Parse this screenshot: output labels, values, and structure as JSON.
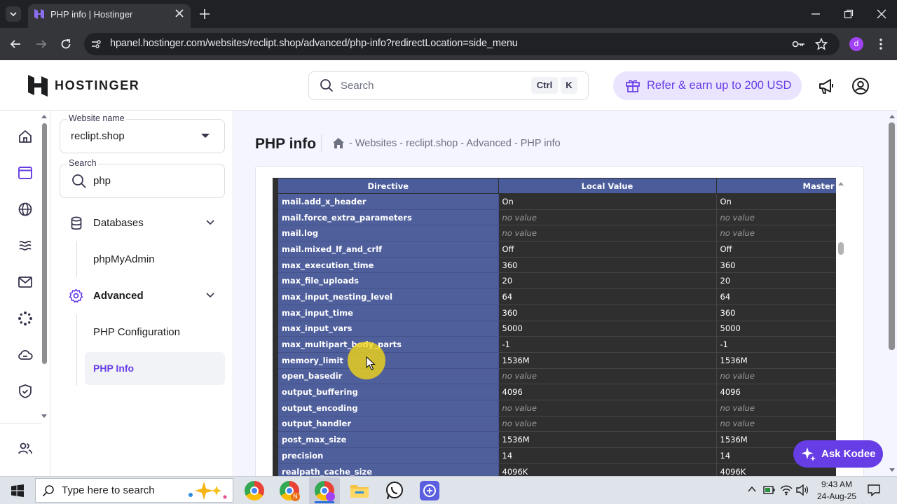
{
  "browser": {
    "tab_title": "PHP info | Hostinger",
    "url": "hpanel.hostinger.com/websites/reclipt.shop/advanced/php-info?redirectLocation=side_menu",
    "profile_initial": "d"
  },
  "header": {
    "logo_text": "HOSTINGER",
    "search_placeholder": "Search",
    "shortcut_keys": [
      "Ctrl",
      "K"
    ],
    "refer_label": "Refer & earn up to 200 USD"
  },
  "sidebar": {
    "website_label": "Website name",
    "website_value": "reclipt.shop",
    "search_label": "Search",
    "search_value": "php",
    "databases_label": "Databases",
    "phpmyadmin_label": "phpMyAdmin",
    "advanced_label": "Advanced",
    "php_config_label": "PHP Configuration",
    "php_info_label": "PHP Info"
  },
  "main": {
    "page_title": "PHP info",
    "breadcrumb": "- Websites - reclipt.shop - Advanced - PHP info",
    "table": {
      "headers": [
        "Directive",
        "Local Value",
        "Master Va"
      ],
      "rows": [
        [
          "mail.add_x_header",
          "On",
          "On"
        ],
        [
          "mail.force_extra_parameters",
          "no value",
          "no value"
        ],
        [
          "mail.log",
          "no value",
          "no value"
        ],
        [
          "mail.mixed_lf_and_crlf",
          "Off",
          "Off"
        ],
        [
          "max_execution_time",
          "360",
          "360"
        ],
        [
          "max_file_uploads",
          "20",
          "20"
        ],
        [
          "max_input_nesting_level",
          "64",
          "64"
        ],
        [
          "max_input_time",
          "360",
          "360"
        ],
        [
          "max_input_vars",
          "5000",
          "5000"
        ],
        [
          "max_multipart_body_parts",
          "-1",
          "-1"
        ],
        [
          "memory_limit",
          "1536M",
          "1536M"
        ],
        [
          "open_basedir",
          "no value",
          "no value"
        ],
        [
          "output_buffering",
          "4096",
          "4096"
        ],
        [
          "output_encoding",
          "no value",
          "no value"
        ],
        [
          "output_handler",
          "no value",
          "no value"
        ],
        [
          "post_max_size",
          "1536M",
          "1536M"
        ],
        [
          "precision",
          "14",
          "14"
        ],
        [
          "realpath_cache_size",
          "4096K",
          "4096K"
        ]
      ]
    },
    "kodee_label": "Ask Kodee"
  },
  "taskbar": {
    "search_placeholder": "Type here to search",
    "time": "9:43 AM",
    "date": "24-Aug-25"
  },
  "colors": {
    "brand_purple": "#673de6",
    "directive_column": "#4f5f9c",
    "value_column": "#2f2f2f"
  }
}
